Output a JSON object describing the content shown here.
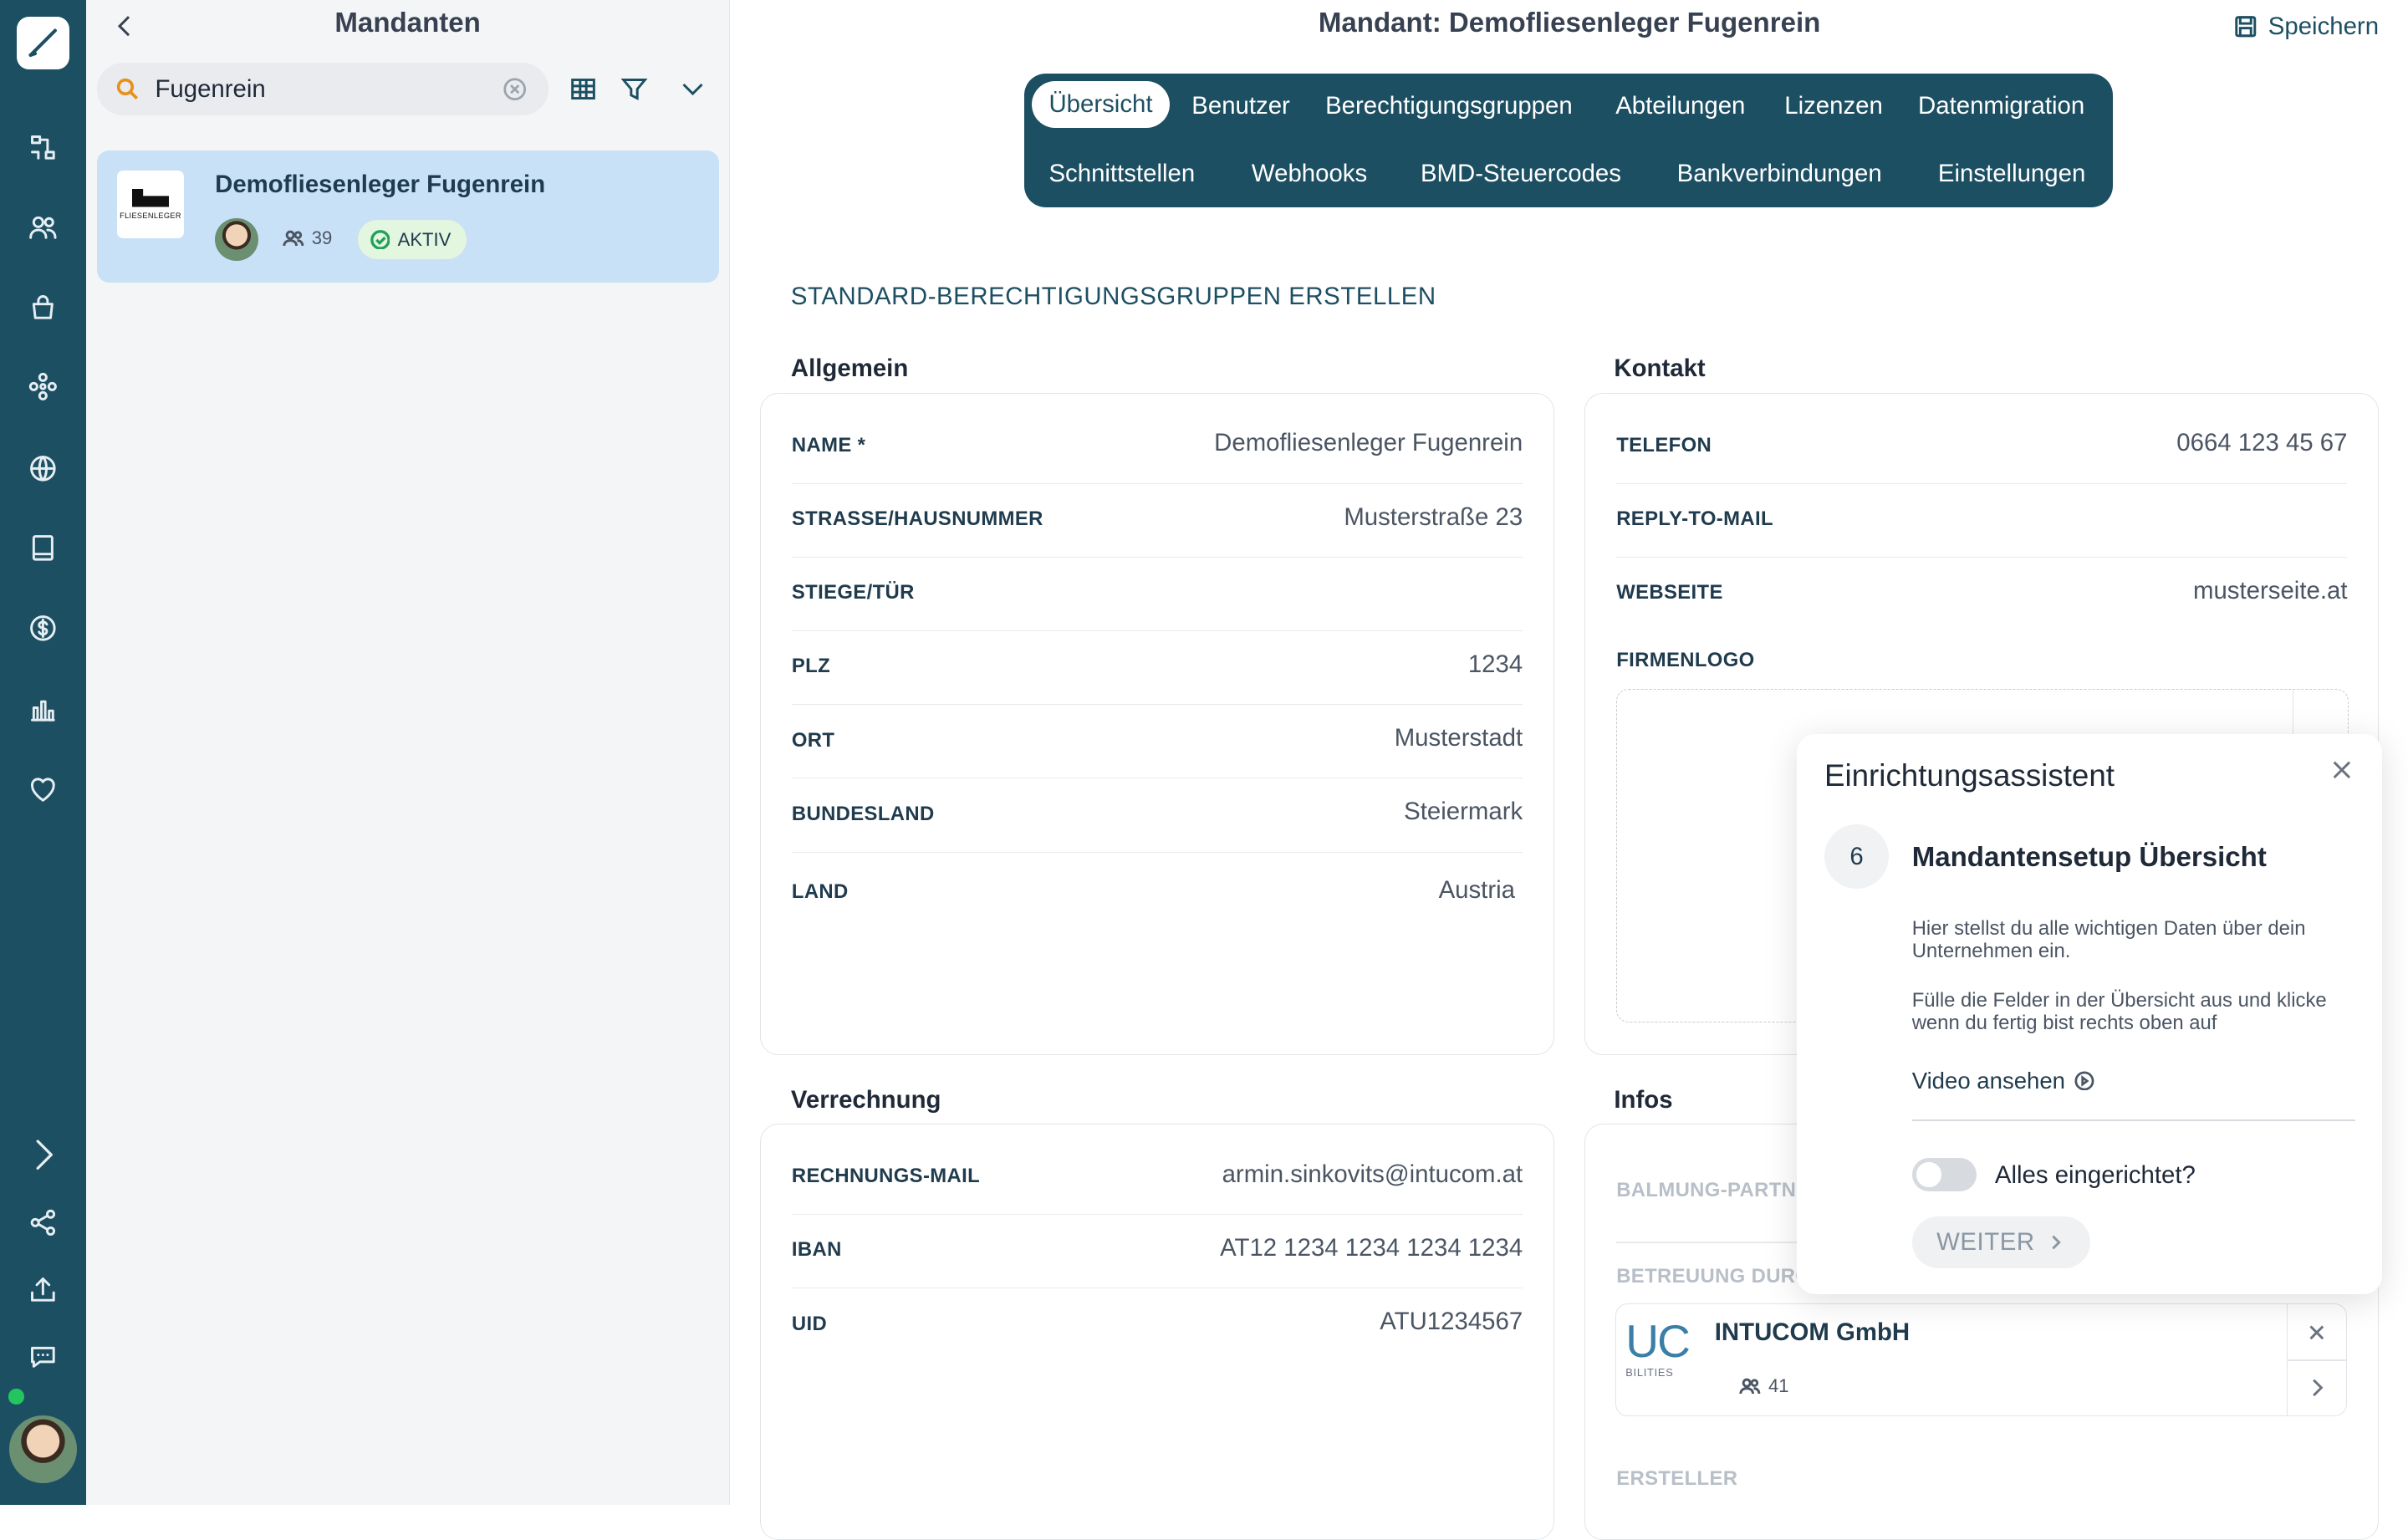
{
  "list_panel": {
    "title": "Mandanten",
    "search_value": "Fugenrein",
    "client": {
      "name": "Demofliesenleger Fugenrein",
      "logo_text": "FLIESENLEGER",
      "user_count": "39",
      "status": "AKTIV"
    }
  },
  "header": {
    "title": "Mandant: Demofliesenleger Fugenrein",
    "save_label": "Speichern"
  },
  "tabs": {
    "row1": [
      "Übersicht",
      "Benutzer",
      "Berechtigungsgruppen",
      "Abteilungen",
      "Lizenzen",
      "Datenmigration"
    ],
    "row2": [
      "Schnittstellen",
      "Webhooks",
      "BMD-Steuercodes",
      "Bankverbindungen",
      "Einstellungen"
    ],
    "active": "Übersicht"
  },
  "create_default_groups": "STANDARD-BERECHTIGUNGSGRUPPEN ERSTELLEN",
  "allgemein": {
    "title": "Allgemein",
    "rows": [
      {
        "label": "NAME *",
        "value": "Demofliesenleger Fugenrein"
      },
      {
        "label": "STRASSE/HAUSNUMMER",
        "value": "Musterstraße 23"
      },
      {
        "label": "STIEGE/TÜR",
        "value": ""
      },
      {
        "label": "PLZ",
        "value": "1234"
      },
      {
        "label": "ORT",
        "value": "Musterstadt"
      },
      {
        "label": "BUNDESLAND",
        "value": "Steiermark"
      },
      {
        "label": "LAND",
        "value": "Austria"
      }
    ]
  },
  "kontakt": {
    "title": "Kontakt",
    "rows": [
      {
        "label": "TELEFON",
        "value": "0664 123 45 67"
      },
      {
        "label": "REPLY-TO-MAIL",
        "value": ""
      },
      {
        "label": "WEBSEITE",
        "value": "musterseite.at"
      }
    ],
    "logo_label": "FIRMENLOGO"
  },
  "verrechnung": {
    "title": "Verrechnung",
    "rows": [
      {
        "label": "RECHNUNGS-MAIL",
        "value": "armin.sinkovits@intucom.at"
      },
      {
        "label": "IBAN",
        "value": "AT12 1234 1234 1234 1234"
      },
      {
        "label": "UID",
        "value": "ATU1234567"
      }
    ]
  },
  "infos": {
    "title": "Infos",
    "partner_label": "BALMUNG-PARTNER",
    "care_label": "BETREUUNG DURCH",
    "creator_label": "ERSTELLER",
    "partner": {
      "logo_text": "UC",
      "logo_sub": "BILITIES",
      "name": "INTUCOM GmbH",
      "user_count": "41"
    }
  },
  "assistant": {
    "title": "Einrichtungsassistent",
    "step": "6",
    "heading": "Mandantensetup Übersicht",
    "para1": "Hier stellst du alle wichtigen Daten über dein Unternehmen ein.",
    "para2": "Fülle die Felder in der Übersicht aus und klicke wenn du fertig bist rechts oben auf",
    "video_label": "Video ansehen",
    "toggle_label": "Alles eingerichtet?",
    "next_label": "WEITER"
  },
  "icons": {
    "rail": [
      "pen-logo-icon",
      "workflow-icon",
      "users-icon",
      "bag-icon",
      "network-icon",
      "globe-icon",
      "book-icon",
      "dollar-icon",
      "chart-icon",
      "heart-icon",
      "expand-icon",
      "share-icon",
      "upload-icon",
      "chat-icon"
    ],
    "accent": "#1d4f63",
    "highlight": "#c9e1f7"
  }
}
